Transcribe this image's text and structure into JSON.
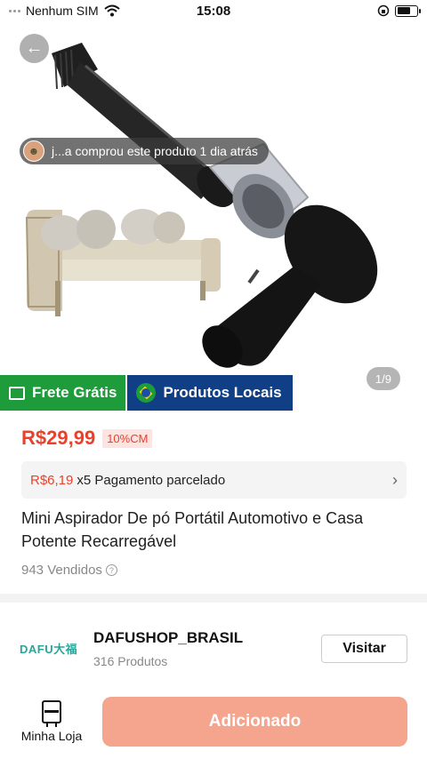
{
  "status_bar": {
    "carrier": "Nenhum SIM",
    "time": "15:08"
  },
  "hero": {
    "recent_purchase": "j...a comprou este produto 1 dia atrás",
    "page_indicator": "1/9",
    "badges": {
      "free_shipping": "Frete Grátis",
      "local_products": "Produtos Locais"
    }
  },
  "product": {
    "price": "R$29,99",
    "discount_tag": "10%CM",
    "installment": {
      "price": "R$6,19",
      "text": "x5 Pagamento parcelado"
    },
    "title": "Mini Aspirador De pó Portátil Automotivo e Casa Potente Recarregável",
    "sold": "943 Vendidos"
  },
  "shop": {
    "logo_text": "DAFU大福",
    "name": "DAFUSHOP_BRASIL",
    "products": "316 Produtos",
    "visit_label": "Visitar"
  },
  "bottom_bar": {
    "my_store_label": "Minha Loja",
    "add_button_label": "Adicionado"
  },
  "colors": {
    "price_red": "#e8412c",
    "free_shipping_green": "#1e9b3a",
    "local_blue": "#113f86",
    "add_button": "#f5a48d"
  }
}
